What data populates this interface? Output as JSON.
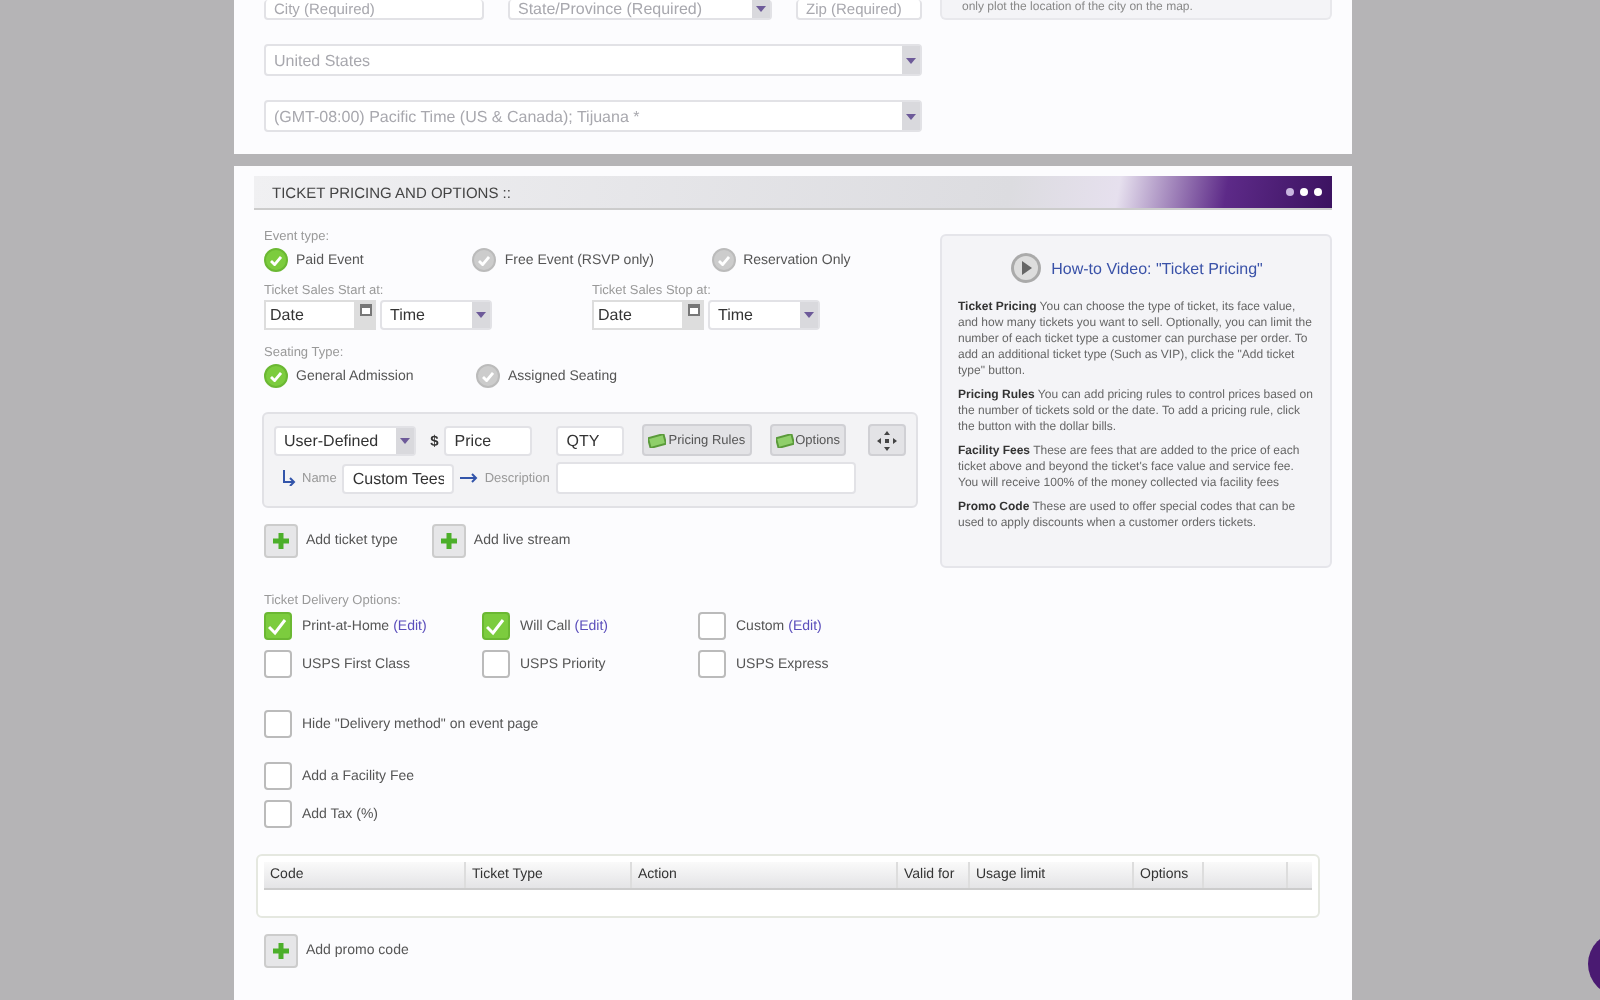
{
  "location": {
    "city": {
      "placeholder": "City (Required)"
    },
    "state": {
      "placeholder": "State/Province (Required)"
    },
    "zip": {
      "placeholder": "Zip (Required)"
    },
    "map_note": "only plot the location of the city on the map.",
    "country": "United States",
    "timezone": "(GMT-08:00) Pacific Time (US & Canada); Tijuana *"
  },
  "ticket_section": {
    "title": "TICKET PRICING AND OPTIONS ::",
    "event_type": {
      "label": "Event type:",
      "options": [
        {
          "label": "Paid Event",
          "selected": true
        },
        {
          "label": "Free Event (RSVP only)",
          "selected": false
        },
        {
          "label": "Reservation Only",
          "selected": false
        }
      ]
    },
    "sales": [
      {
        "label": "Ticket Sales Start at:",
        "date": {
          "placeholder": "Date"
        },
        "time": "Time"
      },
      {
        "label": "Ticket Sales Stop at:",
        "date": {
          "placeholder": "Date"
        },
        "time": "Time"
      }
    ],
    "seating_type": {
      "label": "Seating Type:",
      "options": [
        {
          "label": "General Admission",
          "selected": true
        },
        {
          "label": "Assigned Seating",
          "selected": false
        }
      ]
    },
    "ticket_row": {
      "type": "User-Defined",
      "currency": "$",
      "price": {
        "placeholder": "Price"
      },
      "qty": {
        "placeholder": "QTY"
      },
      "buttons": [
        "Pricing Rules",
        "Options"
      ],
      "name_label": "Name",
      "name": "Custom Tees",
      "description_label": "Description"
    },
    "add_buttons": [
      "Add ticket type",
      "Add live stream"
    ],
    "delivery": {
      "label": "Ticket Delivery Options:",
      "options": [
        {
          "label": "Print-at-Home",
          "edit": "(Edit)",
          "checked": true
        },
        {
          "label": "Will Call",
          "edit": "(Edit)",
          "checked": true
        },
        {
          "label": "Custom",
          "edit": "(Edit)",
          "checked": false
        },
        {
          "label": "USPS First Class",
          "checked": false
        },
        {
          "label": "USPS Priority",
          "checked": false
        },
        {
          "label": "USPS Express",
          "checked": false
        }
      ]
    },
    "extras": [
      {
        "label": "Hide \"Delivery method\" on event page",
        "checked": false
      },
      {
        "label": "Add a Facility Fee",
        "checked": false
      },
      {
        "label": "Add Tax (%)",
        "checked": false
      }
    ],
    "promo_table": {
      "columns": [
        "Code",
        "Ticket Type",
        "Action",
        "Valid for",
        "Usage limit",
        "Options"
      ]
    },
    "add_promo": "Add promo code",
    "help": {
      "video_link": "How-to Video: \"Ticket Pricing\"",
      "paragraphs": [
        "**Ticket Pricing** You can choose the type of ticket, its face value, and how many tickets you want to sell. Optionally, you can limit the number of each ticket type a customer can purchase per order. To add an additional ticket type (Such as VIP), click the \"Add ticket type\" button.",
        "**Pricing Rules** You can add pricing rules to control prices based on the number of tickets sold or the date. To add a pricing rule, click the button with the dollar bills.",
        "**Facility Fees** These are fees that are added to the price of each ticket above and beyond the ticket's face value and service fee. You will receive 100% of the money collected via facility fees",
        "**Promo Code** These are used to offer special codes that can be used to apply discounts when a customer orders tickets."
      ]
    }
  }
}
